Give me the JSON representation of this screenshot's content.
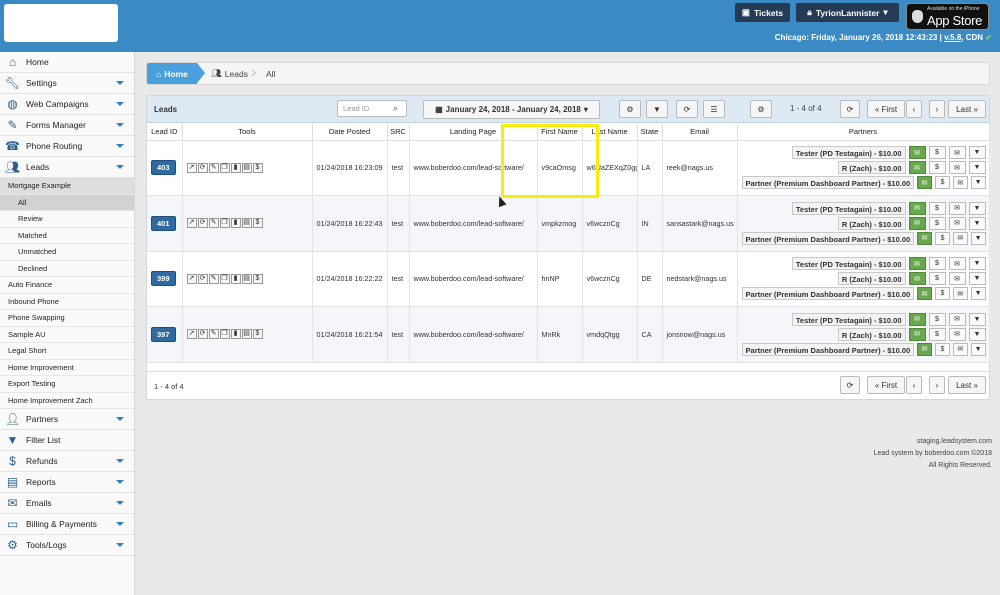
{
  "topbar": {
    "tickets_label": "Tickets",
    "user_label": "TyrionLannister",
    "appstore_small": "Available on the iPhone",
    "appstore_large": "App Store",
    "clock_text": "Chicago: Friday, January 26, 2018 12:43:23 |",
    "version": "v.5.8",
    "cdn": ", CDN"
  },
  "sidebar": {
    "items": [
      {
        "label": "Home",
        "icon": "home-icon",
        "caret": false
      },
      {
        "label": "Settings",
        "icon": "wrench-icon",
        "caret": true
      },
      {
        "label": "Web Campaigns",
        "icon": "globe-icon",
        "caret": true
      },
      {
        "label": "Forms Manager",
        "icon": "form-icon",
        "caret": true
      },
      {
        "label": "Phone Routing",
        "icon": "phone-icon",
        "caret": true
      },
      {
        "label": "Leads",
        "icon": "users-icon",
        "caret": true
      }
    ],
    "leads_sub": [
      {
        "label": "Mortgage Example",
        "level": 1,
        "highlight": true
      },
      {
        "label": "All",
        "level": 2,
        "active": true
      },
      {
        "label": "Review",
        "level": 2
      },
      {
        "label": "Matched",
        "level": 2
      },
      {
        "label": "Unmatched",
        "level": 2
      },
      {
        "label": "Declined",
        "level": 2
      },
      {
        "label": "Auto Finance",
        "level": 1
      },
      {
        "label": "Inbound Phone",
        "level": 1
      },
      {
        "label": "Phone Swapping",
        "level": 1
      },
      {
        "label": "Sample AU",
        "level": 1
      },
      {
        "label": "Legal Short",
        "level": 1
      },
      {
        "label": "Home Improvement",
        "level": 1
      },
      {
        "label": "Export Testing",
        "level": 1
      },
      {
        "label": "Home Improvement Zach",
        "level": 1
      }
    ],
    "items_bottom": [
      {
        "label": "Partners",
        "icon": "partners-icon",
        "caret": true
      },
      {
        "label": "Filter List",
        "icon": "filter-icon",
        "caret": false
      },
      {
        "label": "Refunds",
        "icon": "moneybag-icon",
        "caret": true
      },
      {
        "label": "Reports",
        "icon": "reports-icon",
        "caret": true
      },
      {
        "label": "Emails",
        "icon": "envelope-icon",
        "caret": true
      },
      {
        "label": "Billing & Payments",
        "icon": "credit-card-icon",
        "caret": true
      },
      {
        "label": "Tools/Logs",
        "icon": "cog-icon",
        "caret": true
      }
    ]
  },
  "breadcrumb": {
    "home": "Home",
    "leads": "Leads",
    "all": "All"
  },
  "panel": {
    "title": "Leads",
    "search_placeholder": "Lead ID",
    "date_range": "January 24, 2018 - January 24, 2018",
    "page_info": "1 - 4 of 4",
    "first": "« First",
    "last": "Last »",
    "prev": "‹",
    "next": "›",
    "footer_text": "1 - 4 of 4"
  },
  "table": {
    "headers": [
      "Lead ID",
      "Tools",
      "Date Posted",
      "SRC",
      "Landing Page",
      "First Name",
      "Last Name",
      "State",
      "Email",
      "Partners"
    ],
    "rows": [
      {
        "id": "403",
        "date": "01/24/2018 16:23:09",
        "src": "test",
        "landing": "www.boberdoo.com/lead-software/",
        "first": "v9caOmsg",
        "last": "w6UaZEXqZ0gg",
        "state": "LA",
        "email": "reek@nags.us"
      },
      {
        "id": "401",
        "date": "01/24/2018 16:22:43",
        "src": "test",
        "landing": "www.boberdoo.com/lead-software/",
        "first": "vmpkzmog",
        "last": "v6wcznCg",
        "state": "IN",
        "email": "sansastark@nags.us"
      },
      {
        "id": "399",
        "date": "01/24/2018 16:22:22",
        "src": "test",
        "landing": "www.boberdoo.com/lead-software/",
        "first": "hnNP",
        "last": "v6wcznCg",
        "state": "DE",
        "email": "nedstark@nags.us"
      },
      {
        "id": "397",
        "date": "01/24/2018 16:21:54",
        "src": "test",
        "landing": "www.boberdoo.com/lead-software/",
        "first": "MnRk",
        "last": "vmdqQtgg",
        "state": "CA",
        "email": "jonsnow@nags.us"
      }
    ],
    "partners": [
      "Tester (PD Testagain) - $10.00",
      "R (Zach) - $10.00",
      "Partner (Premium Dashboard Partner) - $10.00"
    ]
  },
  "footer": {
    "line1": "staging.leadsystem.com",
    "line2": "Lead system by boberdoo.com ©2018",
    "line3": "All Rights Reserved."
  },
  "colors": {
    "topbar": "#3b8ac4",
    "accent": "#4aa0dc",
    "highlight_box": "#f5ee0a",
    "partner_green": "#6aa84f"
  }
}
